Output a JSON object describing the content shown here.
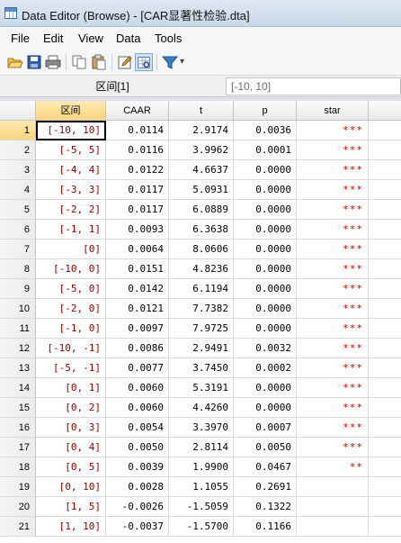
{
  "window": {
    "title": "Data Editor (Browse) - [CAR显著性检验.dta]"
  },
  "menu": [
    "File",
    "Edit",
    "View",
    "Data",
    "Tools"
  ],
  "toolbar": {
    "icons": [
      "open-icon",
      "save-icon",
      "print-icon",
      "copy-icon",
      "paste-icon",
      "edit-mode-icon",
      "browse-mode-icon",
      "filter-icon"
    ],
    "filter_caret": "▾"
  },
  "cellbar": {
    "varname": "区间[1]",
    "value": "[-10, 10]"
  },
  "columns": [
    "区间",
    "CAAR",
    "t",
    "p",
    "star"
  ],
  "rows": [
    {
      "n": "1",
      "interval": "[-10, 10]",
      "caar": "0.0114",
      "t": "2.9174",
      "p": "0.0036",
      "star": "***"
    },
    {
      "n": "2",
      "interval": "[-5, 5]",
      "caar": "0.0116",
      "t": "3.9962",
      "p": "0.0001",
      "star": "***"
    },
    {
      "n": "3",
      "interval": "[-4, 4]",
      "caar": "0.0122",
      "t": "4.6637",
      "p": "0.0000",
      "star": "***"
    },
    {
      "n": "4",
      "interval": "[-3, 3]",
      "caar": "0.0117",
      "t": "5.0931",
      "p": "0.0000",
      "star": "***"
    },
    {
      "n": "5",
      "interval": "[-2, 2]",
      "caar": "0.0117",
      "t": "6.0889",
      "p": "0.0000",
      "star": "***"
    },
    {
      "n": "6",
      "interval": "[-1, 1]",
      "caar": "0.0093",
      "t": "6.3638",
      "p": "0.0000",
      "star": "***"
    },
    {
      "n": "7",
      "interval": "[0]",
      "caar": "0.0064",
      "t": "8.0606",
      "p": "0.0000",
      "star": "***"
    },
    {
      "n": "8",
      "interval": "[-10, 0]",
      "caar": "0.0151",
      "t": "4.8236",
      "p": "0.0000",
      "star": "***"
    },
    {
      "n": "9",
      "interval": "[-5, 0]",
      "caar": "0.0142",
      "t": "6.1194",
      "p": "0.0000",
      "star": "***"
    },
    {
      "n": "10",
      "interval": "[-2, 0]",
      "caar": "0.0121",
      "t": "7.7382",
      "p": "0.0000",
      "star": "***"
    },
    {
      "n": "11",
      "interval": "[-1, 0]",
      "caar": "0.0097",
      "t": "7.9725",
      "p": "0.0000",
      "star": "***"
    },
    {
      "n": "12",
      "interval": "[-10, -1]",
      "caar": "0.0086",
      "t": "2.9491",
      "p": "0.0032",
      "star": "***"
    },
    {
      "n": "13",
      "interval": "[-5, -1]",
      "caar": "0.0077",
      "t": "3.7450",
      "p": "0.0002",
      "star": "***"
    },
    {
      "n": "14",
      "interval": "[0, 1]",
      "caar": "0.0060",
      "t": "5.3191",
      "p": "0.0000",
      "star": "***"
    },
    {
      "n": "15",
      "interval": "[0, 2]",
      "caar": "0.0060",
      "t": "4.4260",
      "p": "0.0000",
      "star": "***"
    },
    {
      "n": "16",
      "interval": "[0, 3]",
      "caar": "0.0054",
      "t": "3.3970",
      "p": "0.0007",
      "star": "***"
    },
    {
      "n": "17",
      "interval": "[0, 4]",
      "caar": "0.0050",
      "t": "2.8114",
      "p": "0.0050",
      "star": "***"
    },
    {
      "n": "18",
      "interval": "[0, 5]",
      "caar": "0.0039",
      "t": "1.9900",
      "p": "0.0467",
      "star": "**"
    },
    {
      "n": "19",
      "interval": "[0, 10]",
      "caar": "0.0028",
      "t": "1.1055",
      "p": "0.2691",
      "star": ""
    },
    {
      "n": "20",
      "interval": "[1, 5]",
      "caar": "-0.0026",
      "t": "-1.5059",
      "p": "0.1322",
      "star": ""
    },
    {
      "n": "21",
      "interval": "[1, 10]",
      "caar": "-0.0037",
      "t": "-1.5700",
      "p": "0.1166",
      "star": ""
    }
  ],
  "colors": {
    "string": "#8b0000",
    "star": "#d20000",
    "selected_header": "#f8d57c"
  }
}
